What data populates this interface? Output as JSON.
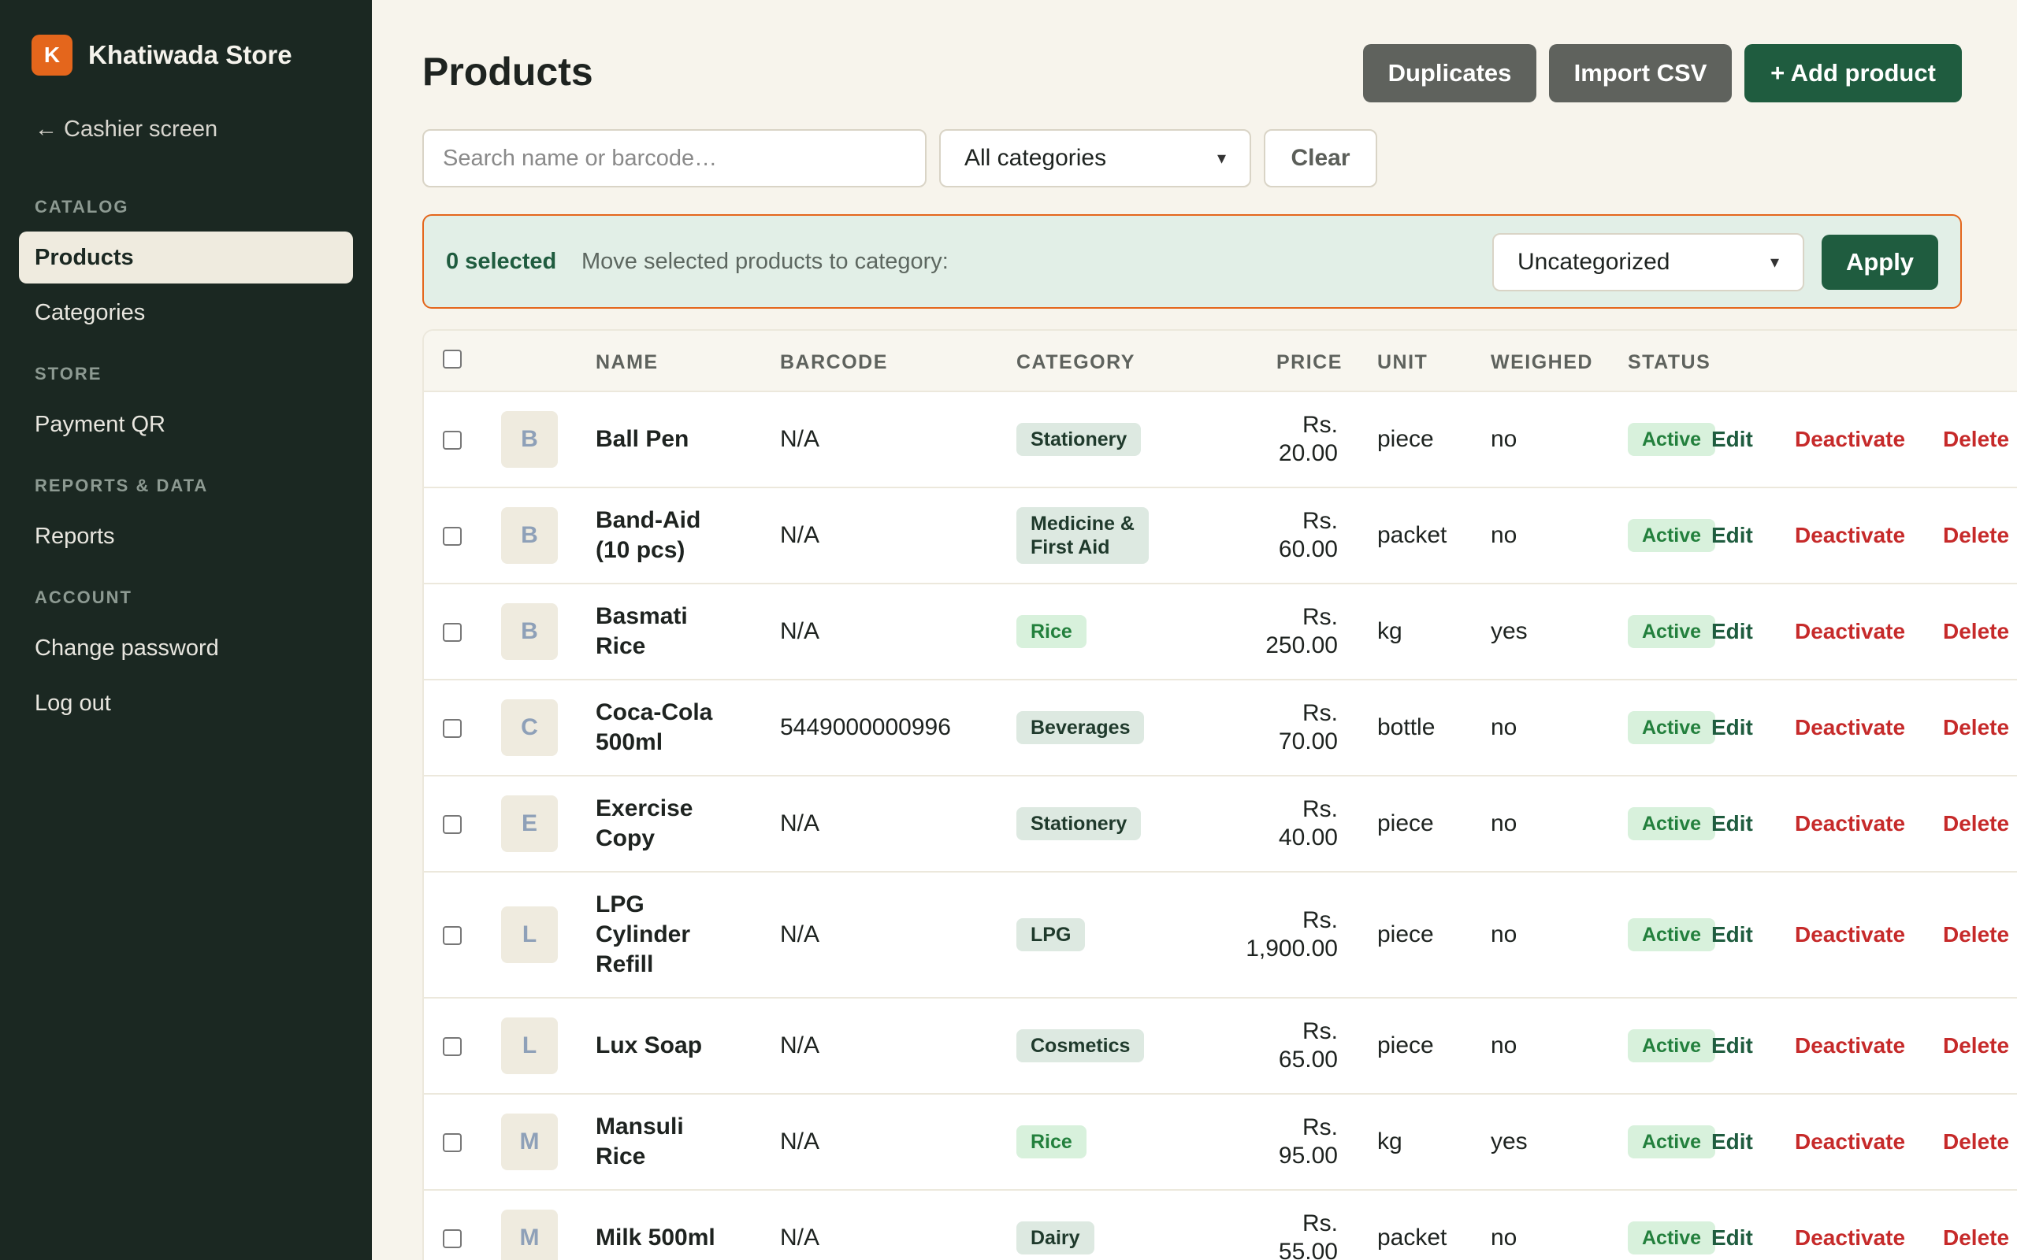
{
  "brand": {
    "initial": "K",
    "name": "Khatiwada Store"
  },
  "sidebar": {
    "back_link": "← Cashier screen",
    "sections": [
      {
        "label": "CATALOG",
        "items": [
          "Products",
          "Categories"
        ]
      },
      {
        "label": "STORE",
        "items": [
          "Payment QR"
        ]
      },
      {
        "label": "REPORTS & DATA",
        "items": [
          "Reports"
        ]
      },
      {
        "label": "ACCOUNT",
        "items": [
          "Change password",
          "Log out"
        ]
      }
    ],
    "active_item": "Products"
  },
  "header": {
    "title": "Products",
    "duplicates_label": "Duplicates",
    "import_label": "Import CSV",
    "add_label": "+ Add product"
  },
  "filters": {
    "search_placeholder": "Search name or barcode…",
    "category_selected": "All categories",
    "clear_label": "Clear"
  },
  "bulk": {
    "count_label": "0 selected",
    "move_label": "Move selected products to category:",
    "target_selected": "Uncategorized",
    "apply_label": "Apply"
  },
  "table": {
    "columns": [
      "NAME",
      "BARCODE",
      "CATEGORY",
      "PRICE",
      "UNIT",
      "WEIGHED",
      "STATUS"
    ],
    "actions": {
      "edit": "Edit",
      "deactivate": "Deactivate",
      "delete": "Delete"
    },
    "rows": [
      {
        "initial": "B",
        "name": [
          "Ball Pen"
        ],
        "barcode": "N/A",
        "category": [
          "Stationery"
        ],
        "price": [
          "Rs.",
          "20.00"
        ],
        "unit": "piece",
        "weighed": "no",
        "status": "Active"
      },
      {
        "initial": "B",
        "name": [
          "Band-Aid",
          "(10 pcs)"
        ],
        "barcode": "N/A",
        "category": [
          "Medicine &",
          "First Aid"
        ],
        "price": [
          "Rs.",
          "60.00"
        ],
        "unit": "packet",
        "weighed": "no",
        "status": "Active"
      },
      {
        "initial": "B",
        "name": [
          "Basmati",
          "Rice"
        ],
        "barcode": "N/A",
        "category": [
          "Rice"
        ],
        "price": [
          "Rs.",
          "250.00"
        ],
        "unit": "kg",
        "weighed": "yes",
        "status": "Active"
      },
      {
        "initial": "C",
        "name": [
          "Coca-Cola",
          "500ml"
        ],
        "barcode": "5449000000996",
        "category": [
          "Beverages"
        ],
        "price": [
          "Rs.",
          "70.00"
        ],
        "unit": "bottle",
        "weighed": "no",
        "status": "Active"
      },
      {
        "initial": "E",
        "name": [
          "Exercise",
          "Copy"
        ],
        "barcode": "N/A",
        "category": [
          "Stationery"
        ],
        "price": [
          "Rs.",
          "40.00"
        ],
        "unit": "piece",
        "weighed": "no",
        "status": "Active"
      },
      {
        "initial": "L",
        "name": [
          "LPG",
          "Cylinder",
          "Refill"
        ],
        "barcode": "N/A",
        "category": [
          "LPG"
        ],
        "price": [
          "Rs.",
          "1,900.00"
        ],
        "unit": "piece",
        "weighed": "no",
        "status": "Active"
      },
      {
        "initial": "L",
        "name": [
          "Lux Soap"
        ],
        "barcode": "N/A",
        "category": [
          "Cosmetics"
        ],
        "price": [
          "Rs.",
          "65.00"
        ],
        "unit": "piece",
        "weighed": "no",
        "status": "Active"
      },
      {
        "initial": "M",
        "name": [
          "Mansuli",
          "Rice"
        ],
        "barcode": "N/A",
        "category": [
          "Rice"
        ],
        "price": [
          "Rs.",
          "95.00"
        ],
        "unit": "kg",
        "weighed": "yes",
        "status": "Active"
      },
      {
        "initial": "M",
        "name": [
          "Milk 500ml"
        ],
        "barcode": "N/A",
        "category": [
          "Dairy"
        ],
        "price": [
          "Rs.",
          "55.00"
        ],
        "unit": "packet",
        "weighed": "no",
        "status": "Active"
      }
    ]
  },
  "colors": {
    "sidebar_bg": "#1b2822",
    "accent_green": "#1f5c3f",
    "brand_orange": "#e4661c",
    "danger_red": "#c62a2a",
    "active_green": "#23803d"
  }
}
